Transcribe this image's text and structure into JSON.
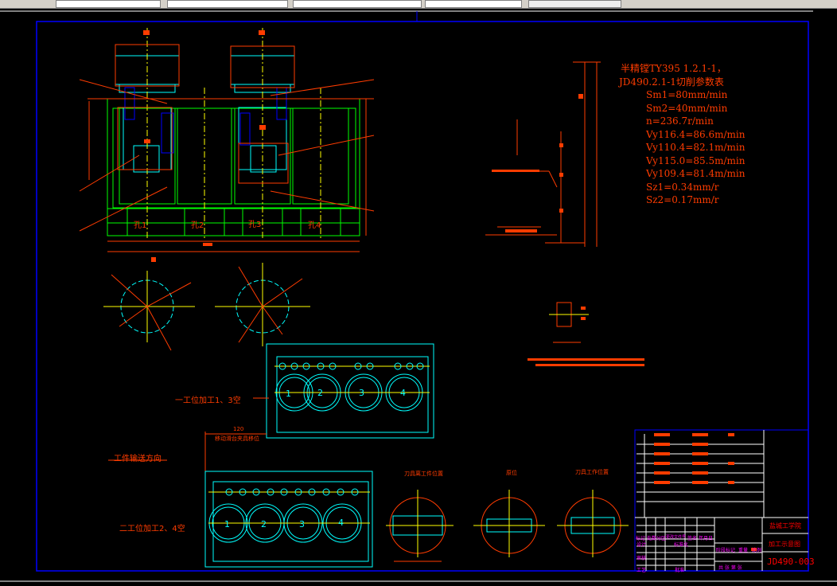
{
  "parameters": {
    "title_line1": "半精镗TY395 1.2.1-1，",
    "title_line2": "JD490.2.1-1切削参数表",
    "rows": [
      "Sm1=80mm/min",
      "Sm2=40mm/min",
      "n=236.7r/min",
      "Vy116.4=86.6m/min",
      "Vy110.4=82.1m/min",
      "Vy115.0=85.5m/min",
      "Vy109.4=81.4m/min",
      "Sz1=0.34mm/r",
      "Sz2=0.17mm/r"
    ]
  },
  "main_view": {
    "holes": [
      "孔1",
      "孔2",
      "孔3",
      "孔4"
    ]
  },
  "stations": {
    "station1_label": "一工位加工1、3空",
    "station2_label": "二工位加工2、4空",
    "transport_label": "工件输送方向",
    "move_label": "移动滑台夹具移位",
    "move_dim": "120",
    "bore_numbers": [
      "1",
      "2",
      "3",
      "4"
    ]
  },
  "sections": {
    "labels": [
      "刀具离工件位置",
      "原位",
      "刀具工作位置"
    ]
  },
  "title_block": {
    "school": "盐城工学院",
    "drawing_name": "加工示意图",
    "drawing_no": "JD490-003",
    "row_labels": [
      "标记",
      "处数",
      "分区",
      "更改文件号",
      "签名",
      "年月日"
    ],
    "left_labels": [
      "设计",
      "审核",
      "工艺"
    ],
    "mid_labels": [
      "标准化",
      "批准"
    ],
    "stage_labels": [
      "阶段标记",
      "重量",
      "比例"
    ],
    "sheet": "共 张 第 张"
  },
  "colors": {
    "background": "#000000",
    "frame": "#0000ff",
    "red": "#ff3c00",
    "green": "#00ff00",
    "cyan": "#00ffff",
    "yellow": "#ffff00",
    "magenta": "#ff00ff",
    "white": "#ffffff"
  }
}
